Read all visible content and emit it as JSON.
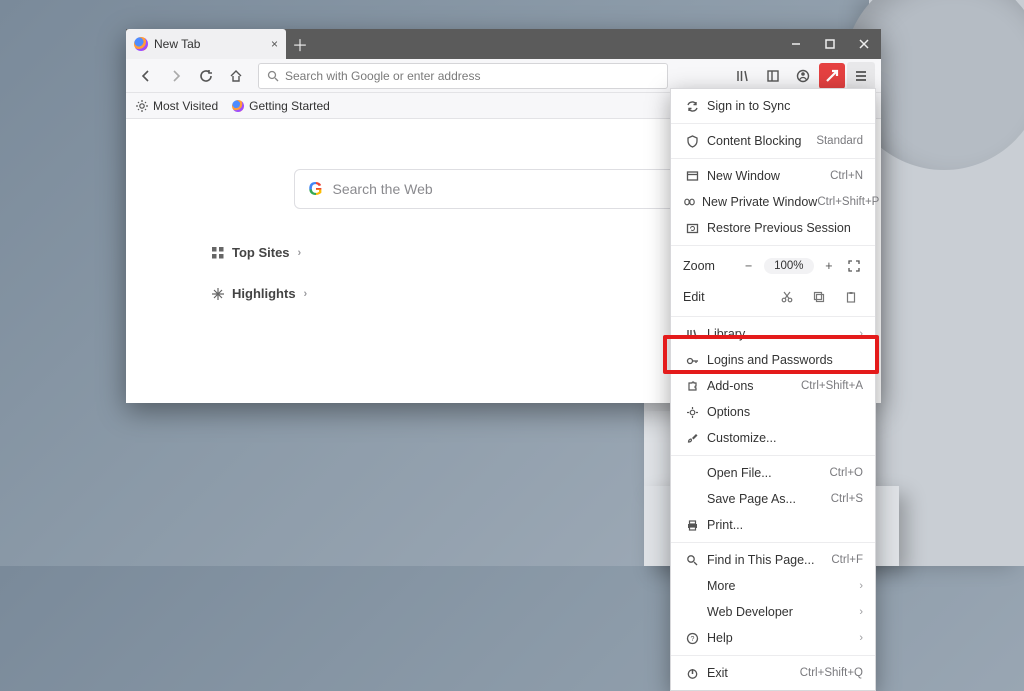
{
  "tab": {
    "title": "New Tab"
  },
  "urlbar": {
    "placeholder": "Search with Google or enter address"
  },
  "bookmarks": {
    "most_visited": "Most Visited",
    "getting_started": "Getting Started"
  },
  "content": {
    "search_placeholder": "Search the Web",
    "top_sites": "Top Sites",
    "highlights": "Highlights"
  },
  "menu": {
    "sign_in": "Sign in to Sync",
    "content_blocking": {
      "label": "Content Blocking",
      "value": "Standard"
    },
    "new_window": {
      "label": "New Window",
      "shortcut": "Ctrl+N"
    },
    "new_private": {
      "label": "New Private Window",
      "shortcut": "Ctrl+Shift+P"
    },
    "restore": "Restore Previous Session",
    "zoom": {
      "label": "Zoom",
      "value": "100%"
    },
    "edit": {
      "label": "Edit"
    },
    "library": "Library",
    "logins": "Logins and Passwords",
    "addons": {
      "label": "Add-ons",
      "shortcut": "Ctrl+Shift+A"
    },
    "options": "Options",
    "customize": "Customize...",
    "open_file": {
      "label": "Open File...",
      "shortcut": "Ctrl+O"
    },
    "save_page": {
      "label": "Save Page As...",
      "shortcut": "Ctrl+S"
    },
    "print": "Print...",
    "find": {
      "label": "Find in This Page...",
      "shortcut": "Ctrl+F"
    },
    "more": "More",
    "web_dev": "Web Developer",
    "help": "Help",
    "exit": {
      "label": "Exit",
      "shortcut": "Ctrl+Shift+Q"
    }
  }
}
